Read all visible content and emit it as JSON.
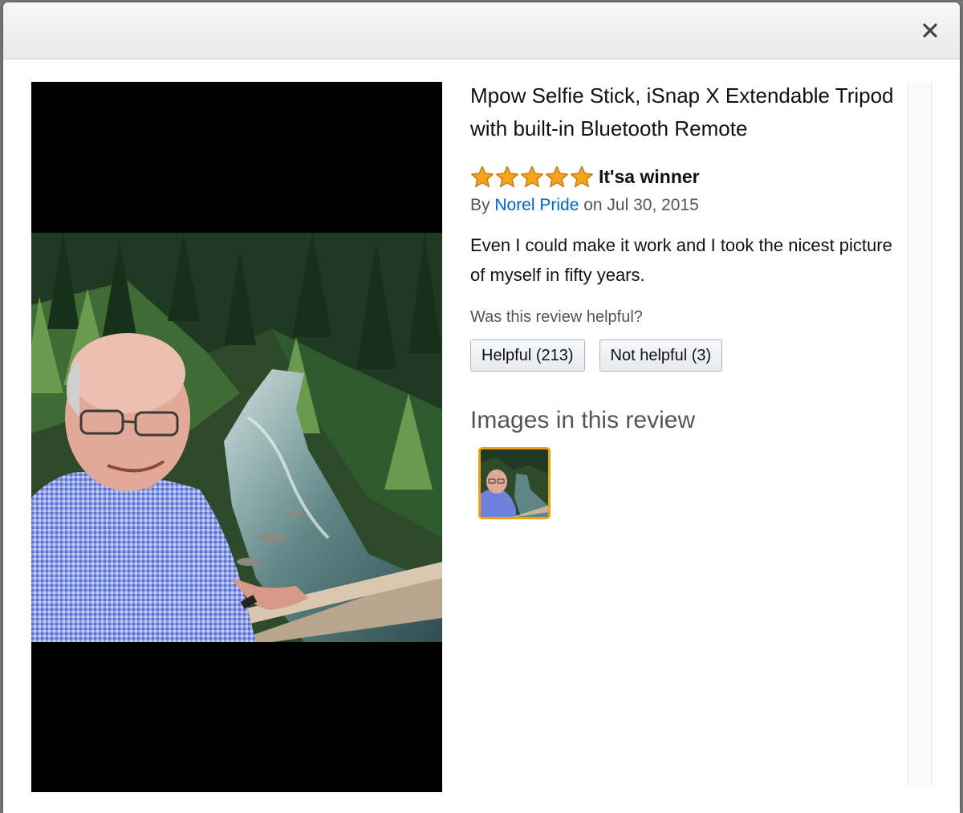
{
  "modal": {
    "close_label": "✕"
  },
  "product": {
    "title": "Mpow Selfie Stick, iSnap X Extendable Tripod with built-in Bluetooth Remote"
  },
  "review": {
    "rating": 5,
    "rating_max": 5,
    "title": "It'sa winner",
    "by_prefix": "By ",
    "author": "Norel Pride",
    "date_text": " on Jul 30, 2015",
    "body": "Even I could make it work and I took the nicest picture of myself in fifty years."
  },
  "helpful": {
    "question": "Was this review helpful?",
    "helpful_label": "Helpful (213)",
    "not_helpful_label": "Not helpful (3)"
  },
  "images_section": {
    "heading": "Images in this review"
  },
  "icons": {
    "close": "close-icon",
    "star": "star-icon"
  },
  "colors": {
    "star_fill": "#f7a41d",
    "star_stroke": "#c77b0a",
    "link": "#0066c0",
    "thumb_border": "#f0a30a"
  }
}
